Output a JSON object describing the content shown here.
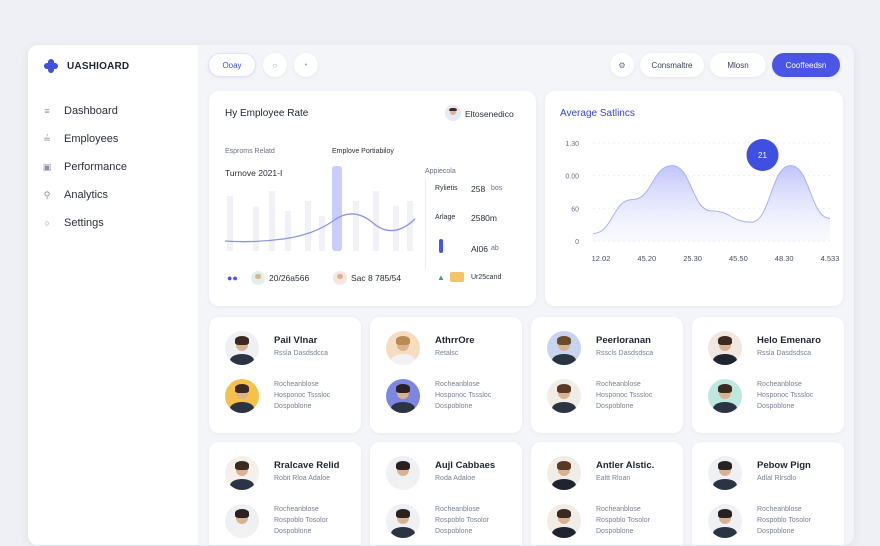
{
  "app": {
    "brand": "UASHIOARD"
  },
  "colors": {
    "accent": "#4a55e6",
    "chart_fill": "#c9cdfa",
    "background": "#eef0f5"
  },
  "sidebar": {
    "items": [
      {
        "label": "Dashboard",
        "icon": "list-icon"
      },
      {
        "label": "Employees",
        "icon": "lines-icon"
      },
      {
        "label": "Performance",
        "icon": "chart-icon"
      },
      {
        "label": "Analytics",
        "icon": "search-icon"
      },
      {
        "label": "Settings",
        "icon": "gear-icon"
      }
    ]
  },
  "topbar": {
    "filter_label": "Ooay",
    "btn_customize": "Consmaltre",
    "btn_mission": "Mlosn",
    "btn_primary": "Cooffeedsn"
  },
  "rate_card": {
    "title": "Hy Employee Rate",
    "user_name": "Eltosenedico",
    "label_left": "Esproms Relatd",
    "turnover_title": "Turnove 2021-I",
    "bar_label": "Emplove Portiabiloy",
    "right_header": "Appiecola",
    "stat1_label": "Rylietis",
    "stat1_value": "258",
    "stat1_unit": "bos",
    "stat2_label": "Arlage",
    "stat2_value": "2580m",
    "stat3_value": "Al06",
    "stat3_unit": "ab",
    "footer_left": "20/26a566",
    "footer_mid": "Sac 8 785/54",
    "footer_right": "Ur25cand"
  },
  "chart_data": {
    "type": "area",
    "title": "Average Satlincs",
    "x": [
      "12.02",
      "45.20",
      "25.30",
      "45.50",
      "48.30",
      "4.533"
    ],
    "y_ticks": [
      "1.30",
      "0.00",
      "60",
      "0"
    ],
    "values": [
      10,
      55,
      100,
      40,
      25,
      100,
      30
    ],
    "ylim": [
      0,
      130
    ],
    "highlight": {
      "label": "21",
      "index": 5
    }
  },
  "employees": [
    {
      "name": "Pail Vlnar",
      "role": "Rssla Dasdsdcca",
      "desc": "Rocheanblose\nHosponoc Tsssloc\nDospoblone"
    },
    {
      "name": "AthrrOre",
      "role": "Retalsc",
      "desc": "Rocheanblose\nHosponoc Tsssloc\nDospoblone"
    },
    {
      "name": "Peerloranan",
      "role": "Rsscls Dasdsdsca",
      "desc": "Rocheanblose\nHosponoc Tsssloc\nDospoblone"
    },
    {
      "name": "Helo Emenaro",
      "role": "Rssla Dasdsdsca",
      "desc": "Rocheanblose\nHosponoc Tsssloc\nDospoblone"
    },
    {
      "name": "Rralcave Relid",
      "role": "Robit Rloa Adaloe",
      "desc": "Rocheanblose\nRospoblo Tosolor\nDospoblone"
    },
    {
      "name": "Aujl Cabbaes",
      "role": "Roda Adaloe",
      "desc": "Rocheanblose\nRospoblo Tosolor\nDospoblone"
    },
    {
      "name": "Antler Alstic.",
      "role": "Ealtt Rloan",
      "desc": "Rocheanblose\nRospoblo Tosolor\nDospoblone"
    },
    {
      "name": "Pebow Pign",
      "role": "Adlal Rlrsdlo",
      "desc": "Rocheanblose\nRospoblo Tosolor\nDospoblone"
    }
  ]
}
